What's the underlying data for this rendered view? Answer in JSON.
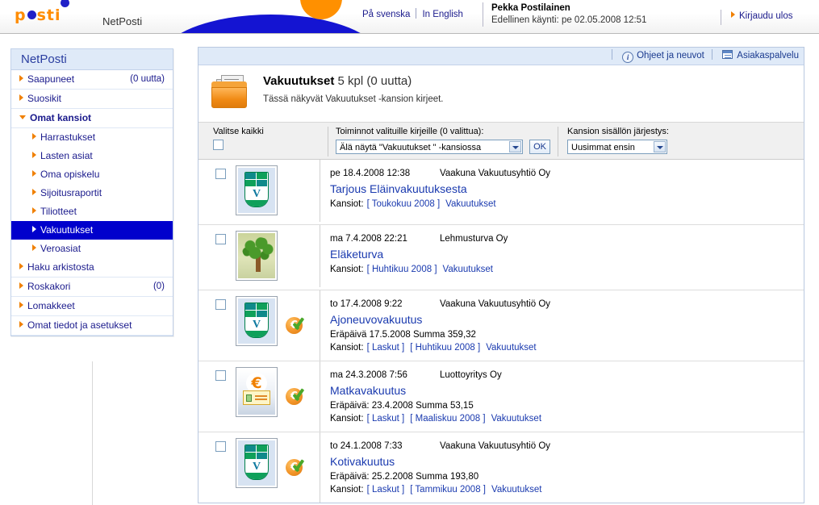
{
  "header": {
    "logo_text_before": "p",
    "logo_text_after": "sti",
    "app_name": "NetPosti",
    "lang_sv": "På svenska",
    "lang_en": "In English",
    "user_name": "Pekka Postilainen",
    "last_visit": "Edellinen käynti: pe 02.05.2008 12:51",
    "logout": "Kirjaudu ulos"
  },
  "sidebar": {
    "title": "NetPosti",
    "items": [
      {
        "label": "Saapuneet",
        "count": "(0 uutta)",
        "level": "top",
        "selected": false,
        "bold": false
      },
      {
        "label": "Suosikit",
        "count": "",
        "level": "top",
        "selected": false,
        "bold": false
      },
      {
        "label": "Omat kansiot",
        "count": "",
        "level": "top",
        "selected": false,
        "bold": true,
        "expanded": true
      },
      {
        "label": "Harrastukset",
        "count": "",
        "level": "sub",
        "selected": false,
        "bold": false
      },
      {
        "label": "Lasten asiat",
        "count": "",
        "level": "sub",
        "selected": false,
        "bold": false
      },
      {
        "label": "Oma opiskelu",
        "count": "",
        "level": "sub",
        "selected": false,
        "bold": false
      },
      {
        "label": "Sijoitusraportit",
        "count": "",
        "level": "sub",
        "selected": false,
        "bold": false
      },
      {
        "label": "Tiliotteet",
        "count": "",
        "level": "sub",
        "selected": false,
        "bold": false
      },
      {
        "label": "Vakuutukset",
        "count": "",
        "level": "sub",
        "selected": true,
        "bold": false
      },
      {
        "label": "Veroasiat",
        "count": "",
        "level": "sub",
        "selected": false,
        "bold": false
      },
      {
        "label": "Haku arkistosta",
        "count": "",
        "level": "top",
        "selected": false,
        "bold": false
      },
      {
        "label": "Roskakori",
        "count": "(0)",
        "level": "top",
        "selected": false,
        "bold": false
      },
      {
        "label": "Lomakkeet",
        "count": "",
        "level": "top",
        "selected": false,
        "bold": false
      },
      {
        "label": "Omat tiedot ja asetukset",
        "count": "",
        "level": "top",
        "selected": false,
        "bold": false
      }
    ]
  },
  "main": {
    "toolbar": {
      "help": "Ohjeet ja neuvot",
      "support": "Asiakaspalvelu"
    },
    "folder": {
      "name": "Vakuutukset",
      "count": "5 kpl (0 uutta)",
      "description": "Tässä näkyvät Vakuutukset -kansion kirjeet."
    },
    "actions": {
      "select_all_label": "Valitse kaikki",
      "actions_label": "Toiminnot valituille kirjeille (0 valittua):",
      "actions_selected": "Älä näytä \"Vakuutukset \" -kansiossa",
      "ok_label": "OK",
      "sort_label": "Kansion sisällön järjestys:",
      "sort_selected": "Uusimmat ensin"
    },
    "messages": [
      {
        "date": "pe 18.4.2008 12:38",
        "sender": "Vaakuna Vakuutusyhtiö Oy",
        "subject": "Tarjous Eläinvakuutuksesta",
        "due": "",
        "folders_prefix": "Kansiot:",
        "folders": [
          "[ Toukokuu 2008 ]",
          "Vakuutukset"
        ],
        "logo": "shield-logo",
        "badge": false
      },
      {
        "date": "ma 7.4.2008 22:21",
        "sender": "Lehmusturva Oy",
        "subject": "Eläketurva",
        "due": "",
        "folders_prefix": "Kansiot:",
        "folders": [
          "[ Huhtikuu 2008 ]",
          "Vakuutukset"
        ],
        "logo": "tree-logo",
        "badge": false
      },
      {
        "date": "to 17.4.2008 9:22",
        "sender": "Vaakuna Vakuutusyhtiö Oy",
        "subject": "Ajoneuvovakuutus",
        "due": "Eräpäivä 17.5.2008  Summa 359,32",
        "folders_prefix": "Kansiot:",
        "folders": [
          "[ Laskut ]",
          "[ Huhtikuu 2008 ]",
          "Vakuutukset"
        ],
        "logo": "shield-logo",
        "badge": true
      },
      {
        "date": "ma 24.3.2008 7:56",
        "sender": "Luottoyritys Oy",
        "subject": "Matkavakuutus",
        "due": "Eräpäivä: 23.4.2008  Summa 53,15",
        "folders_prefix": "Kansiot:",
        "folders": [
          "[ Laskut ]",
          "[ Maaliskuu 2008 ]",
          "Vakuutukset"
        ],
        "logo": "euro-note-logo",
        "badge": true
      },
      {
        "date": "to 24.1.2008 7:33",
        "sender": "Vaakuna Vakuutusyhtiö Oy",
        "subject": "Kotivakuutus",
        "due": "Eräpäivä: 25.2.2008  Summa 193,80",
        "folders_prefix": "Kansiot:",
        "folders": [
          "[ Laskut ]",
          "[ Tammikuu 2008 ]",
          "Vakuutukset"
        ],
        "logo": "shield-logo",
        "badge": true
      }
    ]
  },
  "colors": {
    "brand_orange": "#ff8c00",
    "brand_blue": "#2020c8",
    "selected_blue": "#0000cc",
    "link_blue": "#1a3aaf"
  }
}
